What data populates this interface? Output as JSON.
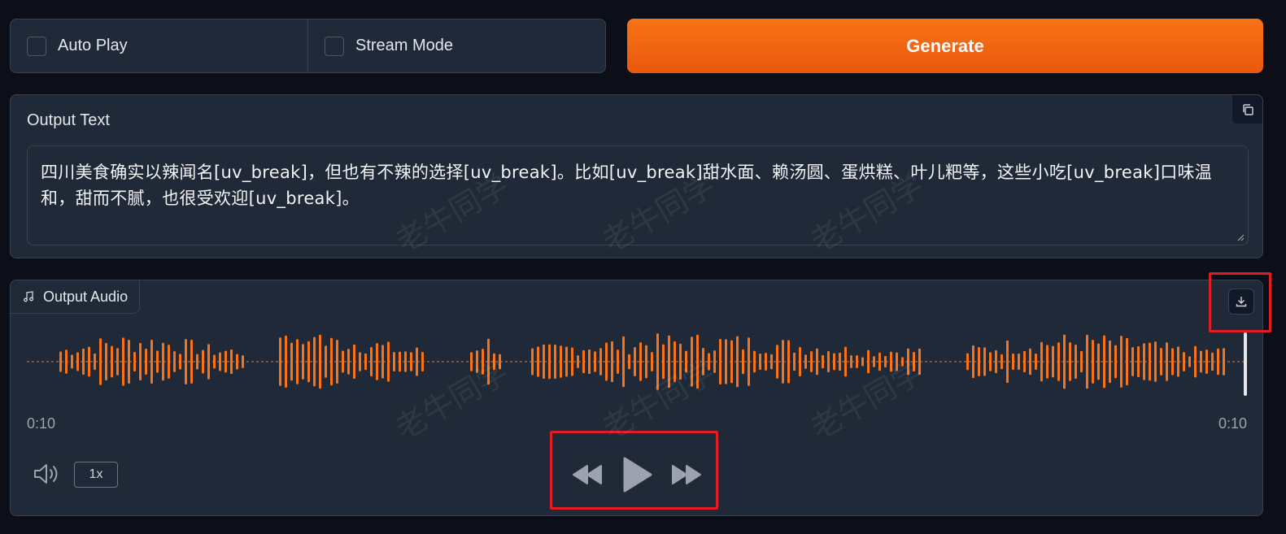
{
  "options": {
    "auto_play_label": "Auto Play",
    "stream_mode_label": "Stream Mode",
    "auto_play_checked": false,
    "stream_mode_checked": false
  },
  "generate_label": "Generate",
  "output_text": {
    "label": "Output Text",
    "value": "四川美食确实以辣闻名[uv_break]，但也有不辣的选择[uv_break]。比如[uv_break]甜水面、赖汤圆、蛋烘糕、叶儿粑等，这些小吃[uv_break]口味温和，甜而不腻，也很受欢迎[uv_break]。"
  },
  "output_audio": {
    "label": "Output Audio",
    "current_time": "0:10",
    "duration": "0:10",
    "playback_rate": "1x",
    "waveform_color": "#f97316"
  },
  "watermark": "老牛同学",
  "colors": {
    "accent": "#f97316",
    "accent_dark": "#ea580c",
    "panel_bg": "#1f2937",
    "page_bg": "#0c0f17",
    "highlight": "#e11d23"
  }
}
